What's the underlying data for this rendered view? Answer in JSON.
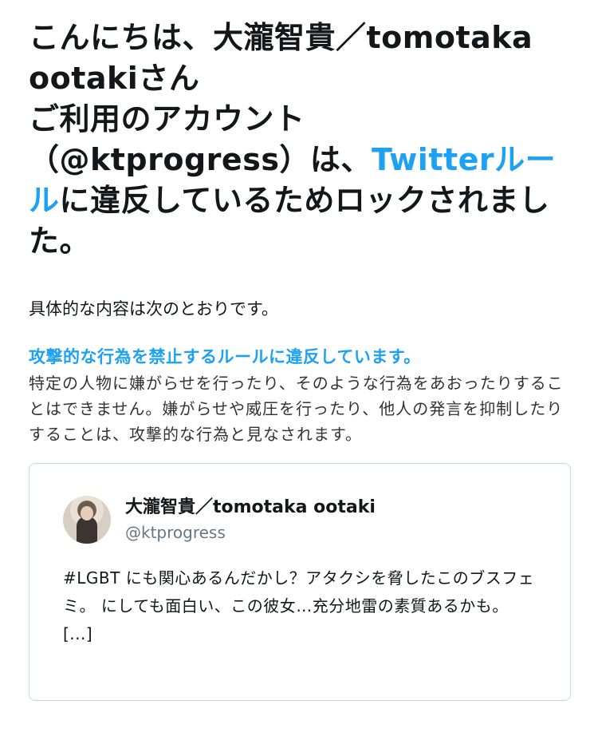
{
  "headline": {
    "line1": "こんにちは、大瀧智貴／tomotaka",
    "line2": "ootakiさん",
    "line3": "ご利用のアカウント",
    "line4_prefix": "（@ktprogress）は、",
    "rules_link": "Twitterルール",
    "line4_suffix": "に違反しているためロックされました。"
  },
  "intro": "具体的な内容は次のとおりです。",
  "rule": {
    "title": "攻撃的な行為を禁止するルールに違反しています。",
    "description": "特定の人物に嫌がらせを行ったり、そのような行為をあおったりすることはできません。嫌がらせや威圧を行ったり、他人の発言を抑制したりすることは、攻撃的な行為と見なされます。"
  },
  "tweet": {
    "display_name": "大瀧智貴／tomotaka ootaki",
    "handle": "@ktprogress",
    "text": "#LGBT にも関心あるんだかし？アタクシを脅したこのブスフェミ。 にしても面白い、この彼女…充分地雷の素質あるかも。 [...]"
  },
  "colors": {
    "link": "#1da1f2",
    "text": "#14171a",
    "handle": "#657786",
    "card_border": "#ccd6dd"
  }
}
